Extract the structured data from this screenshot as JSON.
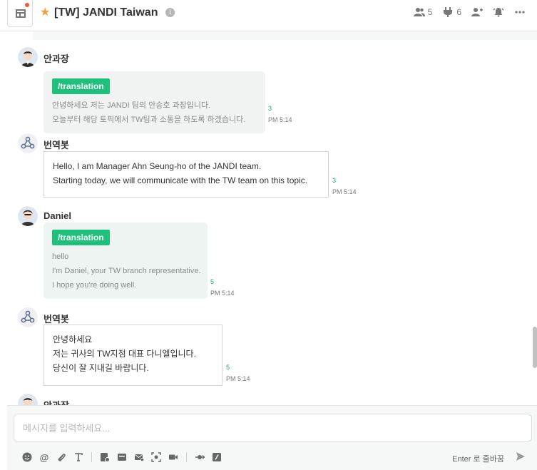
{
  "header": {
    "title": "[TW] JANDI Taiwan",
    "members_count": "5",
    "connect_count": "6"
  },
  "messages": [
    {
      "sender": "안과장",
      "command": "/translation",
      "lines": [
        "안녕하세요 저는 JANDI 팀의 안승호 과장입니다.",
        "오늘부터 해당 토픽에서 TW팀과 소통을 하도록 하겠습니다."
      ],
      "unread": "3",
      "time": "PM 5:14"
    },
    {
      "sender": "번역봇",
      "lines": [
        "Hello, I am Manager Ahn Seung-ho of the JANDI team.",
        "Starting today, we will communicate with the TW team on this topic."
      ],
      "unread": "3",
      "time": "PM 5:14"
    },
    {
      "sender": "Daniel",
      "command": "/translation",
      "lines": [
        "hello",
        "I'm Daniel, your TW branch representative.",
        "I hope you're doing well."
      ],
      "unread": "5",
      "time": "PM 5:14"
    },
    {
      "sender": "번역봇",
      "lines": [
        "안녕하세요",
        "저는 귀사의 TW지점 대표 다니엘입니다.",
        "당신이 잘 지내길 바랍니다."
      ],
      "unread": "5",
      "time": "PM 5:14"
    },
    {
      "sender": "안과장"
    }
  ],
  "composer": {
    "placeholder": "메시지를 입력하세요...",
    "enter_hint": "Enter 로 줄바꿈"
  },
  "colors": {
    "accent_green": "#1fc07b",
    "star": "#f0a03c",
    "notification_dot": "#e85d3b"
  }
}
